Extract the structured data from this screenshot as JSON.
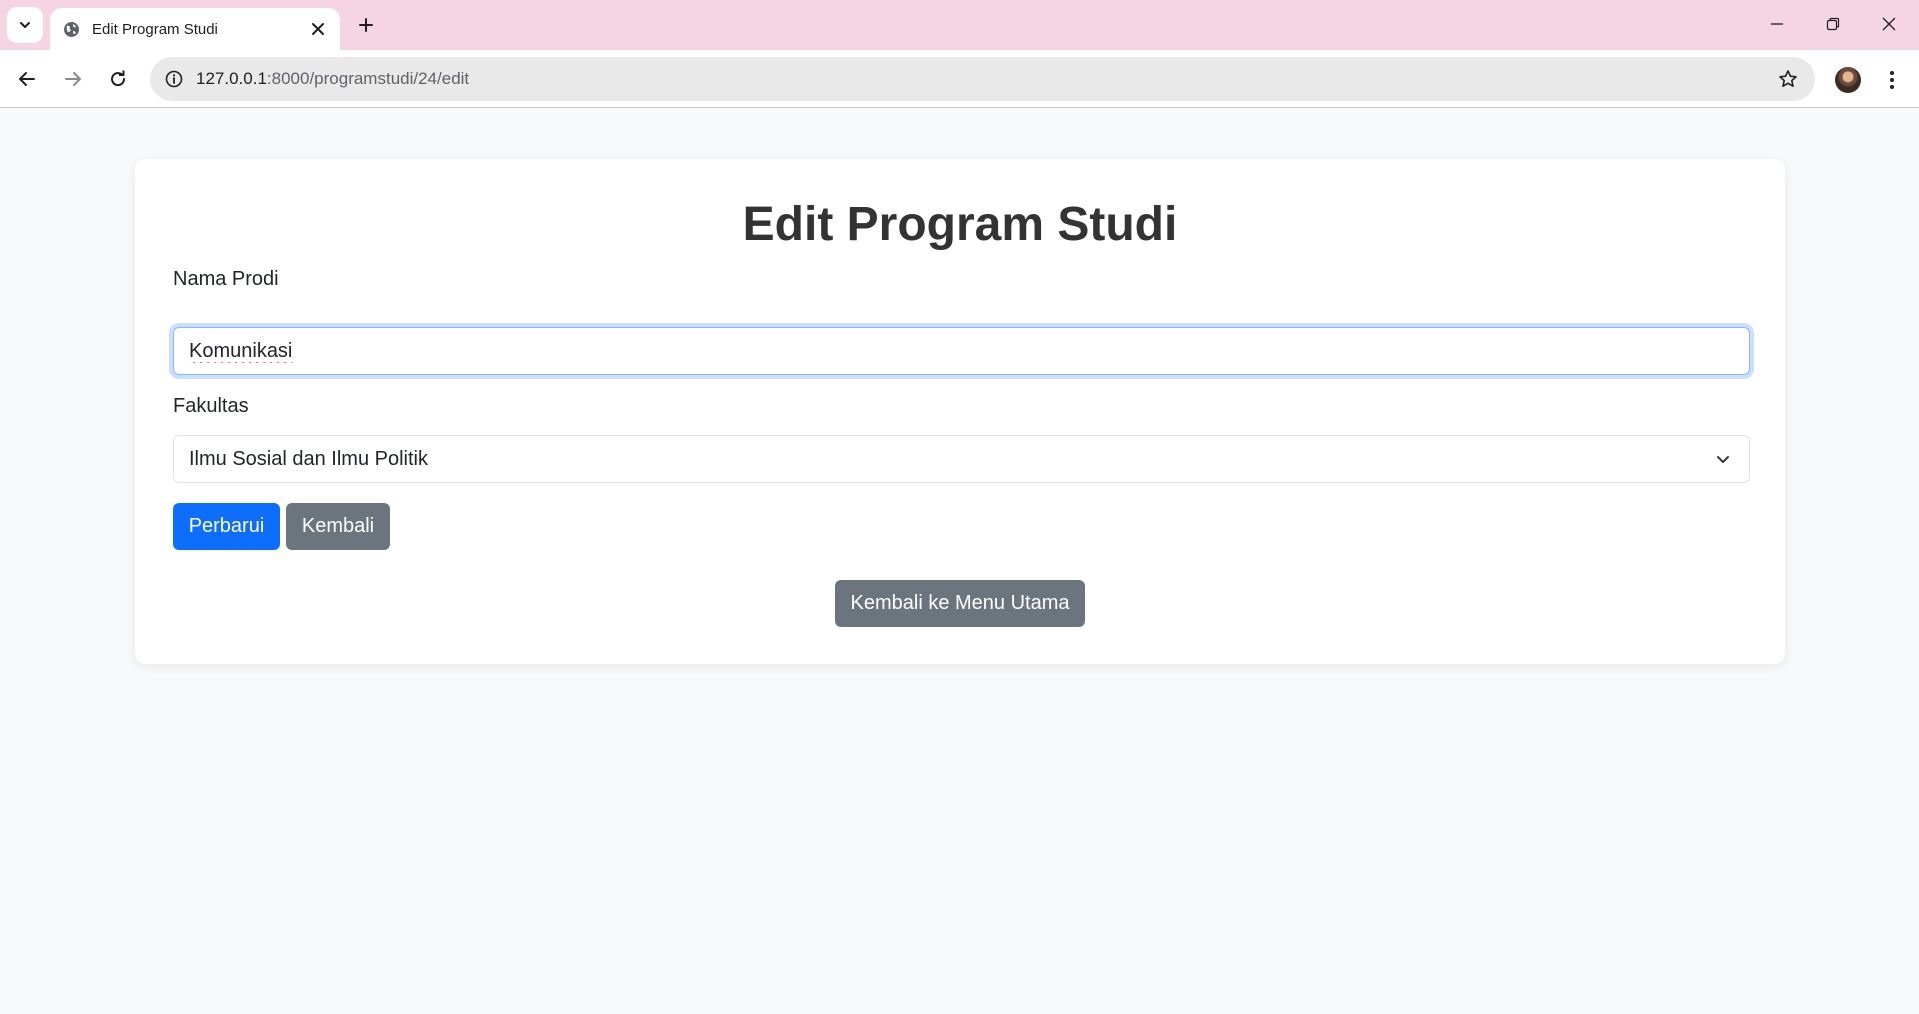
{
  "browser": {
    "tab_title": "Edit Program Studi",
    "url_host": "127.0.0.1",
    "url_path": ":8000/programstudi/24/edit"
  },
  "page": {
    "title": "Edit Program Studi",
    "form": {
      "nama_prodi_label": "Nama Prodi",
      "nama_prodi_value": "Komunikasi",
      "fakultas_label": "Fakultas",
      "fakultas_selected": "Ilmu Sosial dan Ilmu Politik"
    },
    "buttons": {
      "update": "Perbarui",
      "back": "Kembali",
      "main_menu": "Kembali ke Menu Utama"
    }
  },
  "colors": {
    "tabbar": "#f6d5e2",
    "primary": "#0d6efd",
    "secondary": "#6c757d",
    "page_bg": "#f8f9fa"
  }
}
